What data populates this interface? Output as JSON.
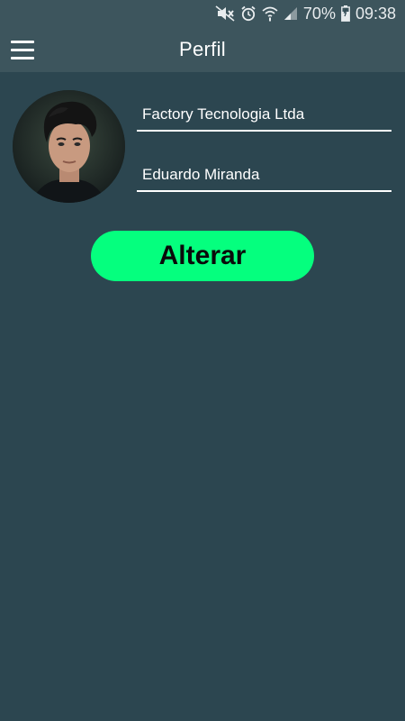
{
  "status_bar": {
    "battery": "70%",
    "time": "09:38"
  },
  "app_bar": {
    "title": "Perfil"
  },
  "profile": {
    "company": "Factory Tecnologia Ltda",
    "name": "Eduardo Miranda"
  },
  "actions": {
    "alter_label": "Alterar"
  },
  "colors": {
    "background": "#2c4650",
    "app_bar": "#3d555d",
    "accent": "#05ff7e"
  },
  "icons": [
    "menu-icon",
    "mute-icon",
    "alarm-icon",
    "wifi-icon",
    "signal-icon",
    "battery-icon"
  ]
}
